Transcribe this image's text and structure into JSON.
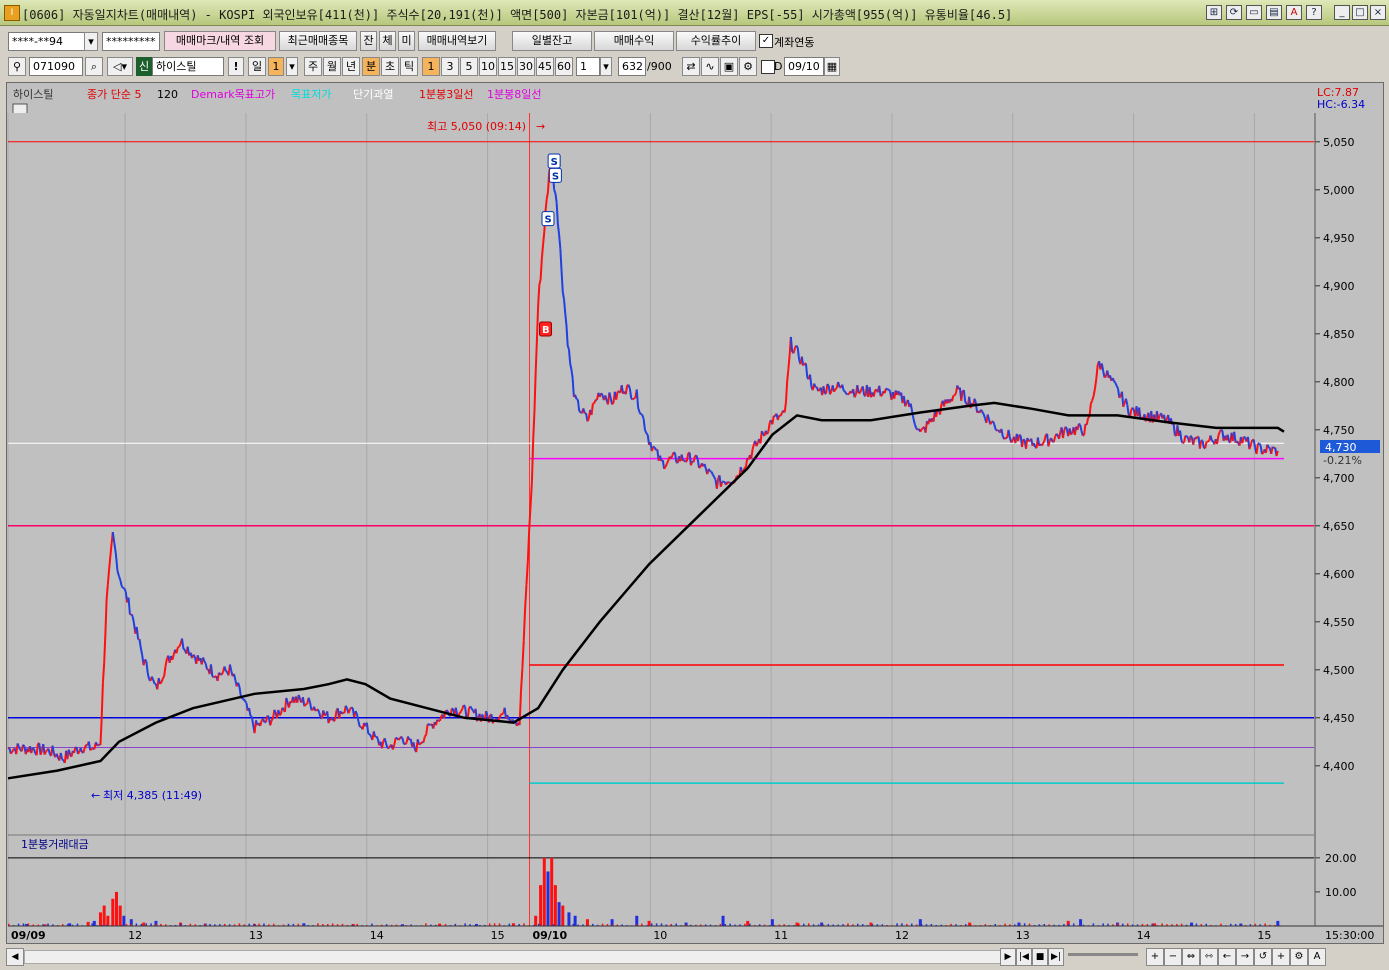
{
  "window": {
    "title": "[0606] 자동일지차트(매매내역) - KOSPI 외국인보유[411(천)] 주식수[20,191(천)] 액면[500] 자본금[101(억)] 결산[12월] EPS[-55] 시가총액[955(억)] 유통비율[46.5]"
  },
  "toolbar1": {
    "account": "****-**94",
    "password": "*********",
    "trade_mark_btn": "매매마크/내역 조회",
    "recent_btn": "최근매매종목",
    "jan": "잔",
    "che": "체",
    "mi": "미",
    "history_btn": "매매내역보기",
    "daily_balance": "일별잔고",
    "trade_profit": "매매수익",
    "return_trend": "수익률추이",
    "account_link": "계좌연동"
  },
  "toolbar2": {
    "code": "071090",
    "badge": "신",
    "stock_name": "하이스틸",
    "period_tabs": [
      "일",
      "주",
      "월",
      "년",
      "분",
      "초",
      "틱"
    ],
    "day_count": "1",
    "minute_options": [
      "1",
      "3",
      "5",
      "10",
      "15",
      "30",
      "45",
      "60"
    ],
    "interval": "1",
    "count": "632",
    "count_total": "/900",
    "d_label": "D",
    "date": "09/10"
  },
  "legend": [
    "하이스틸",
    "종가 단순 5",
    "120",
    "Demark목표고가",
    "목표저가",
    "단기과열",
    "1분봉3일선",
    "1분봉8일선"
  ],
  "lc_hc": {
    "lc": "LC:7.87",
    "hc": "HC:-6.34"
  },
  "price_panel": {
    "high_label": "최고 5,050 (09:14)",
    "low_label": "최저 4,385 (11:49)",
    "current_price": "4,730",
    "current_change": "-0.21%",
    "yticks": [
      "5,050",
      "5,000",
      "4,950",
      "4,900",
      "4,850",
      "4,800",
      "4,750",
      "4,700",
      "4,650",
      "4,600",
      "4,550",
      "4,500",
      "4,450",
      "4,400"
    ]
  },
  "volume_panel": {
    "label": "1분봉거래대금",
    "yticks": [
      "20.00",
      "10.00"
    ]
  },
  "x_axis": {
    "labels": [
      "09/09",
      "12",
      "13",
      "14",
      "15",
      "09/10",
      "10",
      "11",
      "12",
      "13",
      "14",
      "15"
    ],
    "time_label": "15:30:00"
  },
  "chart_data": {
    "type": "candlestick",
    "ylim": [
      4330,
      5080
    ],
    "hlines": [
      {
        "y": 5050,
        "color": "#ff0000"
      },
      {
        "y": 4736,
        "color": "#ffffff"
      },
      {
        "y": 4720,
        "color": "#ff00ff"
      },
      {
        "y": 4650,
        "color": "#ff0066"
      },
      {
        "y": 4505,
        "color": "#ff0000"
      },
      {
        "y": 4450,
        "color": "#0000dd"
      },
      {
        "y": 4419,
        "color": "#8844cc"
      },
      {
        "y": 4382,
        "color": "#00cccc"
      }
    ],
    "price_path": [
      [
        0.0,
        4418
      ],
      [
        0.02,
        4418
      ],
      [
        0.035,
        4415
      ],
      [
        0.045,
        4408
      ],
      [
        0.06,
        4420
      ],
      [
        0.07,
        4418
      ],
      [
        0.075,
        4425
      ],
      [
        0.08,
        4570
      ],
      [
        0.085,
        4640
      ],
      [
        0.09,
        4600
      ],
      [
        0.1,
        4560
      ],
      [
        0.11,
        4510
      ],
      [
        0.12,
        4480
      ],
      [
        0.13,
        4510
      ],
      [
        0.14,
        4530
      ],
      [
        0.155,
        4510
      ],
      [
        0.17,
        4495
      ],
      [
        0.18,
        4500
      ],
      [
        0.19,
        4470
      ],
      [
        0.2,
        4440
      ],
      [
        0.215,
        4450
      ],
      [
        0.23,
        4470
      ],
      [
        0.245,
        4465
      ],
      [
        0.26,
        4450
      ],
      [
        0.275,
        4460
      ],
      [
        0.29,
        4440
      ],
      [
        0.3,
        4425
      ],
      [
        0.31,
        4420
      ],
      [
        0.32,
        4430
      ],
      [
        0.33,
        4418
      ],
      [
        0.345,
        4445
      ],
      [
        0.36,
        4460
      ],
      [
        0.375,
        4455
      ],
      [
        0.39,
        4450
      ],
      [
        0.405,
        4455
      ],
      [
        0.415,
        4445
      ],
      [
        0.425,
        4700
      ],
      [
        0.43,
        4880
      ],
      [
        0.435,
        4960
      ],
      [
        0.44,
        5030
      ],
      [
        0.445,
        4990
      ],
      [
        0.45,
        4900
      ],
      [
        0.455,
        4830
      ],
      [
        0.46,
        4780
      ],
      [
        0.47,
        4760
      ],
      [
        0.48,
        4790
      ],
      [
        0.49,
        4780
      ],
      [
        0.5,
        4795
      ],
      [
        0.51,
        4785
      ],
      [
        0.52,
        4740
      ],
      [
        0.53,
        4715
      ],
      [
        0.54,
        4720
      ],
      [
        0.555,
        4720
      ],
      [
        0.565,
        4710
      ],
      [
        0.575,
        4695
      ],
      [
        0.59,
        4700
      ],
      [
        0.605,
        4730
      ],
      [
        0.62,
        4760
      ],
      [
        0.63,
        4765
      ],
      [
        0.635,
        4840
      ],
      [
        0.645,
        4820
      ],
      [
        0.655,
        4790
      ],
      [
        0.67,
        4795
      ],
      [
        0.69,
        4790
      ],
      [
        0.71,
        4790
      ],
      [
        0.73,
        4780
      ],
      [
        0.74,
        4745
      ],
      [
        0.755,
        4770
      ],
      [
        0.77,
        4790
      ],
      [
        0.785,
        4775
      ],
      [
        0.8,
        4755
      ],
      [
        0.815,
        4740
      ],
      [
        0.83,
        4735
      ],
      [
        0.845,
        4740
      ],
      [
        0.86,
        4750
      ],
      [
        0.875,
        4750
      ],
      [
        0.885,
        4820
      ],
      [
        0.895,
        4800
      ],
      [
        0.91,
        4770
      ],
      [
        0.925,
        4765
      ],
      [
        0.94,
        4760
      ],
      [
        0.955,
        4740
      ],
      [
        0.97,
        4735
      ],
      [
        0.985,
        4745
      ],
      [
        1.0,
        4740
      ],
      [
        1.015,
        4730
      ],
      [
        1.03,
        4728
      ]
    ],
    "ma120_path": [
      [
        0.0,
        4387
      ],
      [
        0.04,
        4395
      ],
      [
        0.075,
        4405
      ],
      [
        0.09,
        4425
      ],
      [
        0.12,
        4445
      ],
      [
        0.15,
        4460
      ],
      [
        0.2,
        4475
      ],
      [
        0.24,
        4480
      ],
      [
        0.26,
        4485
      ],
      [
        0.275,
        4490
      ],
      [
        0.29,
        4485
      ],
      [
        0.31,
        4470
      ],
      [
        0.34,
        4460
      ],
      [
        0.37,
        4450
      ],
      [
        0.41,
        4445
      ],
      [
        0.43,
        4460
      ],
      [
        0.45,
        4500
      ],
      [
        0.48,
        4550
      ],
      [
        0.52,
        4610
      ],
      [
        0.56,
        4660
      ],
      [
        0.6,
        4710
      ],
      [
        0.62,
        4745
      ],
      [
        0.64,
        4765
      ],
      [
        0.66,
        4760
      ],
      [
        0.7,
        4760
      ],
      [
        0.74,
        4768
      ],
      [
        0.78,
        4775
      ],
      [
        0.8,
        4778
      ],
      [
        0.83,
        4772
      ],
      [
        0.86,
        4765
      ],
      [
        0.9,
        4765
      ],
      [
        0.94,
        4758
      ],
      [
        0.98,
        4752
      ],
      [
        1.03,
        4752
      ],
      [
        1.035,
        4748
      ]
    ],
    "signals": [
      {
        "label": "S",
        "x": 0.443,
        "y": 5030
      },
      {
        "label": "S",
        "x": 0.444,
        "y": 5015
      },
      {
        "label": "S",
        "x": 0.438,
        "y": 4970
      },
      {
        "label": "B",
        "x": 0.436,
        "y": 4855
      }
    ],
    "volume_ylim": [
      0,
      22
    ],
    "volume_bars": [
      [
        0.015,
        0.6,
        "b"
      ],
      [
        0.03,
        0.5,
        "r"
      ],
      [
        0.05,
        0.8,
        "b"
      ],
      [
        0.065,
        1.2,
        "r"
      ],
      [
        0.07,
        1.5,
        "b"
      ],
      [
        0.075,
        4,
        "r"
      ],
      [
        0.078,
        6,
        "r"
      ],
      [
        0.081,
        3,
        "r"
      ],
      [
        0.085,
        8,
        "r"
      ],
      [
        0.088,
        10,
        "r"
      ],
      [
        0.091,
        6,
        "r"
      ],
      [
        0.094,
        3,
        "b"
      ],
      [
        0.1,
        2,
        "b"
      ],
      [
        0.11,
        1,
        "r"
      ],
      [
        0.12,
        1.5,
        "b"
      ],
      [
        0.14,
        1,
        "r"
      ],
      [
        0.16,
        0.7,
        "b"
      ],
      [
        0.2,
        0.6,
        "r"
      ],
      [
        0.24,
        0.8,
        "b"
      ],
      [
        0.28,
        0.6,
        "r"
      ],
      [
        0.32,
        0.5,
        "b"
      ],
      [
        0.35,
        0.7,
        "r"
      ],
      [
        0.38,
        0.6,
        "b"
      ],
      [
        0.41,
        0.8,
        "r"
      ],
      [
        0.428,
        3,
        "r"
      ],
      [
        0.432,
        12,
        "r"
      ],
      [
        0.435,
        20,
        "r"
      ],
      [
        0.438,
        16,
        "b"
      ],
      [
        0.441,
        20,
        "r"
      ],
      [
        0.444,
        12,
        "r"
      ],
      [
        0.447,
        7,
        "b"
      ],
      [
        0.45,
        6,
        "r"
      ],
      [
        0.455,
        4,
        "b"
      ],
      [
        0.46,
        3,
        "b"
      ],
      [
        0.47,
        2,
        "r"
      ],
      [
        0.49,
        2,
        "b"
      ],
      [
        0.51,
        3,
        "b"
      ],
      [
        0.52,
        1.5,
        "r"
      ],
      [
        0.55,
        1,
        "b"
      ],
      [
        0.58,
        3,
        "b"
      ],
      [
        0.6,
        1.5,
        "r"
      ],
      [
        0.62,
        2,
        "b"
      ],
      [
        0.64,
        1,
        "r"
      ],
      [
        0.66,
        1,
        "b"
      ],
      [
        0.7,
        1,
        "r"
      ],
      [
        0.74,
        2,
        "b"
      ],
      [
        0.78,
        1,
        "r"
      ],
      [
        0.82,
        1,
        "b"
      ],
      [
        0.86,
        1.5,
        "r"
      ],
      [
        0.87,
        2,
        "b"
      ],
      [
        0.9,
        1,
        "b"
      ],
      [
        0.93,
        0.8,
        "r"
      ],
      [
        0.96,
        1,
        "b"
      ],
      [
        1.0,
        0.7,
        "b"
      ],
      [
        1.03,
        1.5,
        "b"
      ]
    ]
  }
}
